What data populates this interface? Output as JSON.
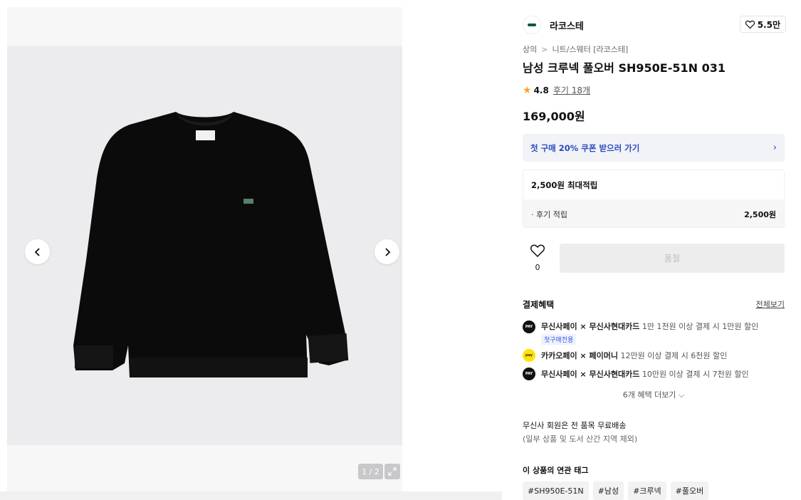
{
  "gallery": {
    "pager": "1 / 2",
    "icons": {
      "prev": "chevron-left-icon",
      "next": "chevron-right-icon",
      "expand": "expand-icon"
    }
  },
  "brand": {
    "name": "라코스테",
    "likes": "5.5만",
    "logo_color": "#0c5a34"
  },
  "breadcrumb": [
    "상의",
    "니트/스웨터 [라코스테]"
  ],
  "product": {
    "title": "남성 크루넥 풀오버 SH950E-51N 031",
    "rating": "4.8",
    "reviews": "후기 18개",
    "price": "169,000원"
  },
  "coupon": {
    "label": "첫 구매 20% 쿠폰 받으러 가기",
    "color": "#2b4bbd"
  },
  "points": {
    "title": "2,500원 최대적립",
    "row_label": "· 후기 적립",
    "row_amount": "2,500원"
  },
  "wishlist": {
    "count": "0"
  },
  "buy_button": {
    "label": "품절"
  },
  "benefits": {
    "title": "결제혜택",
    "view_all": "전체보기",
    "items": [
      {
        "brand": "무신사페이 × 무신사현대카드",
        "detail": "1만 1천원 이상 결제 시 1만원 할인",
        "tag": "첫구매전용",
        "icon": "musinsa-pay-icon"
      },
      {
        "brand": "카카오페이 × 페이머니",
        "detail": "12만원 이상 결제 시 6천원 할인",
        "tag": "",
        "icon": "kakao-pay-icon"
      },
      {
        "brand": "무신사페이 × 무신사현대카드",
        "detail": "10만원 이상 결제 시 7천원 할인",
        "tag": "",
        "icon": "musinsa-pay-icon"
      }
    ],
    "more": "6개 혜택 더보기"
  },
  "shipping": {
    "title": "무신사 회원은 전 품목 무료배송",
    "sub": "(일부 상품 및 도서 산간 지역 제외)"
  },
  "tags": {
    "title": "이 상품의 연관 태그",
    "items": [
      "#SH950E-51N",
      "#남성",
      "#크루넥",
      "#풀오버"
    ]
  }
}
